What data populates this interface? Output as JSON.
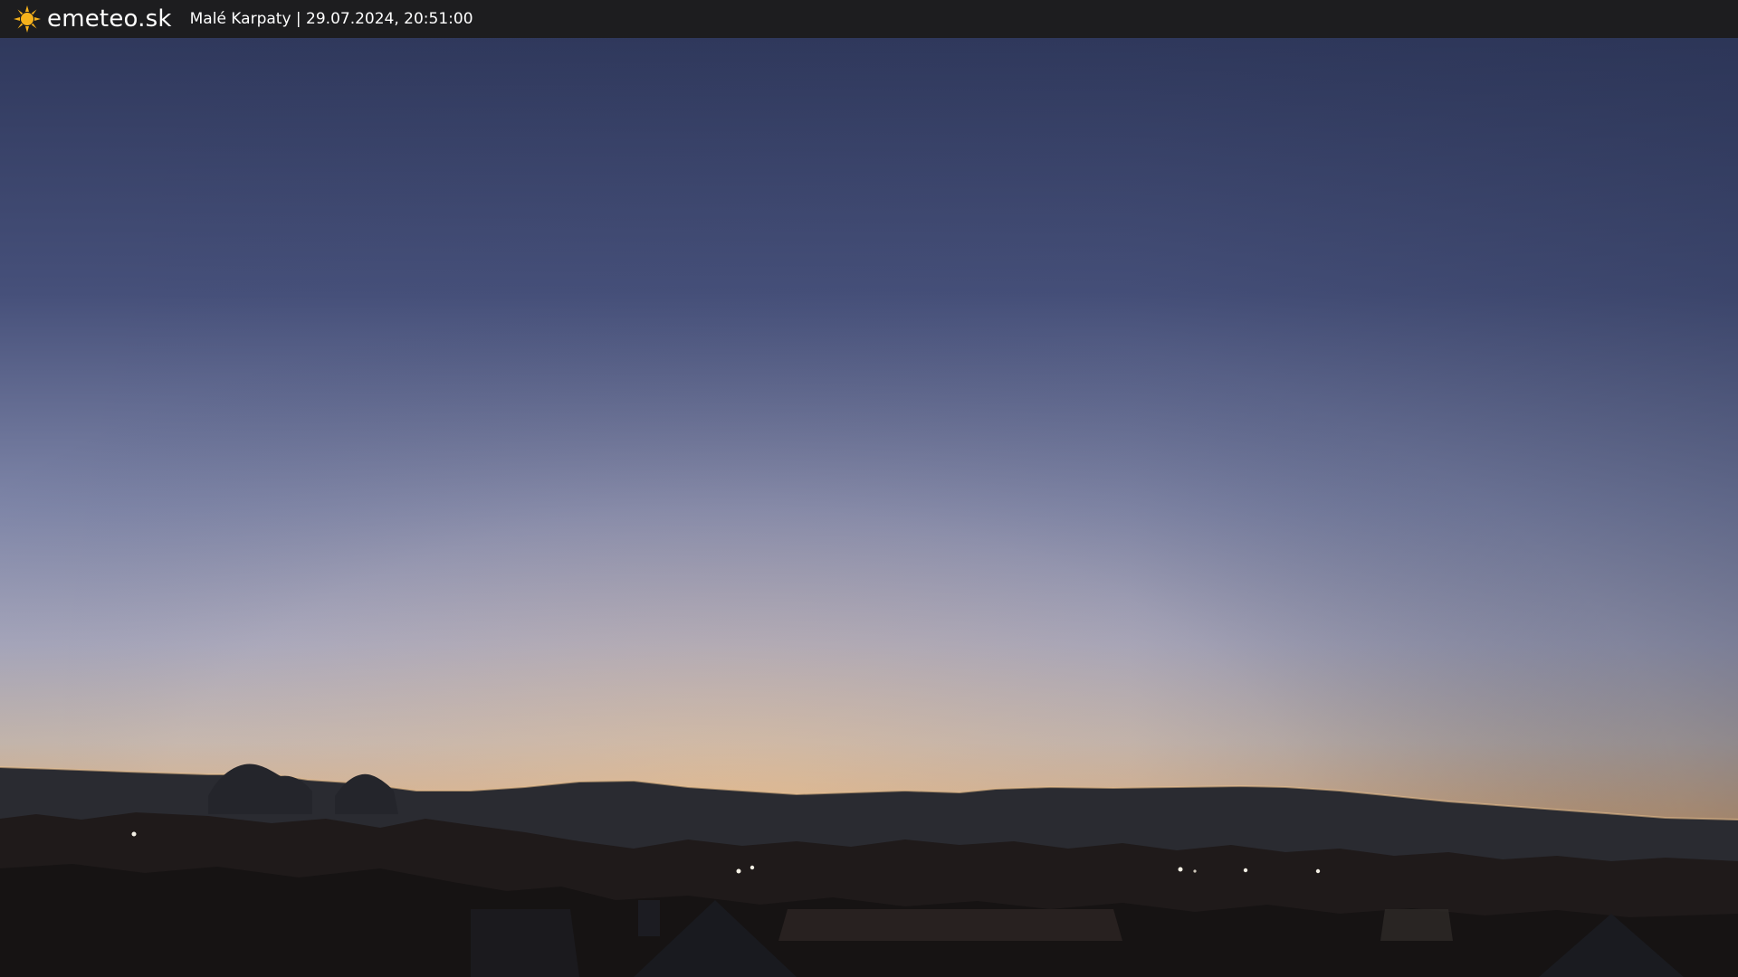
{
  "header": {
    "logo_text": "emeteo.sk",
    "caption": "Malé Karpaty | 29.07.2024, 20:51:00",
    "logo_icon": "sun-icon",
    "logo_color": "#f6b21b",
    "background_color": "#1d1d1f"
  },
  "scene": {
    "subject": "dusk sky over hill ridge",
    "colors": {
      "sky_top": "#2c3558",
      "sky_mid": "#7f86a8",
      "sky_horizon": "#e3b27c",
      "ridge": "#2a2b31",
      "foreground": "#1c1717"
    }
  }
}
